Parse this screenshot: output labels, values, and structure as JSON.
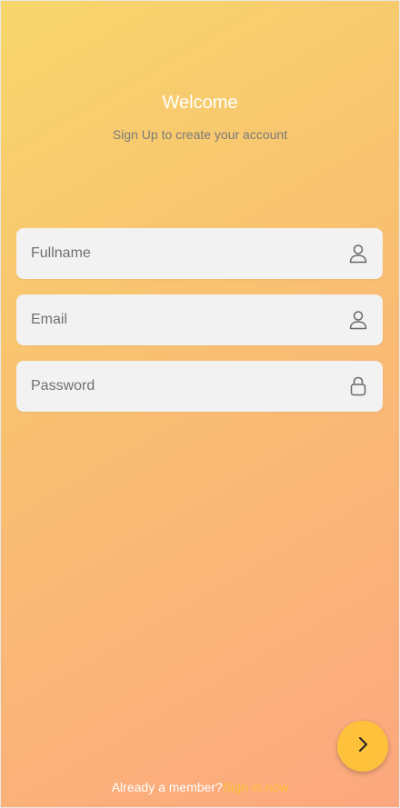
{
  "header": {
    "title": "Welcome",
    "subtitle": "Sign Up to create your account"
  },
  "form": {
    "fullname": {
      "placeholder": "Fullname",
      "value": "",
      "icon": "user-icon"
    },
    "email": {
      "placeholder": "Email",
      "value": "",
      "icon": "user-icon"
    },
    "password": {
      "placeholder": "Password",
      "value": "",
      "icon": "lock-icon"
    }
  },
  "actions": {
    "next_icon": "chevron-right-icon"
  },
  "footer": {
    "prompt": "Already a member?",
    "link_label": "Sign in now"
  },
  "colors": {
    "gradient_start": "#f8d66b",
    "gradient_end": "#fca77f",
    "accent": "#fdc13c",
    "field_bg": "#f2f2f2"
  }
}
